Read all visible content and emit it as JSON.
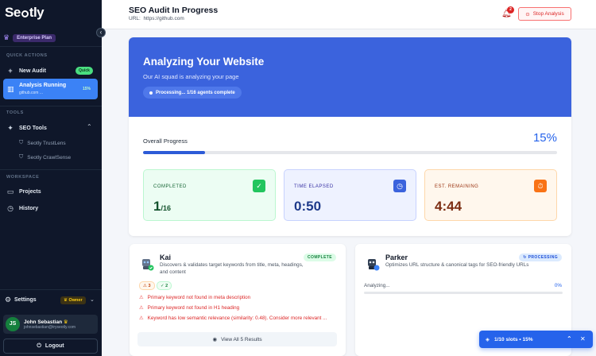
{
  "sidebar": {
    "logo": {
      "prefix": "Se",
      "suffix": "tly"
    },
    "plan_badge": "Enterprise Plan",
    "quick_actions_title": "QUICK ACTIONS",
    "new_audit": {
      "label": "New Audit",
      "badge": "Quick"
    },
    "analysis_running": {
      "label": "Analysis Running",
      "subtitle": "github.com ...",
      "percent": "15%"
    },
    "tools_title": "TOOLS",
    "seo_tools": {
      "label": "SEO Tools",
      "items": [
        {
          "label": "Seotly TrustLens"
        },
        {
          "label": "Seotly CrawlSense"
        }
      ]
    },
    "workspace_title": "WORKSPACE",
    "projects": "Projects",
    "history": "History",
    "settings": {
      "label": "Settings",
      "badge": "Owner"
    },
    "user": {
      "initials": "JS",
      "name": "John Sebastian",
      "email": "johnsebastian@tryseotly.com"
    },
    "logout": "Logout"
  },
  "header": {
    "title": "SEO Audit In Progress",
    "url_label": "URL:",
    "url": "https://github.com",
    "notification_count": "2",
    "stop_label": "Stop Analysis"
  },
  "hero": {
    "title": "Analyzing Your Website",
    "subtitle": "Our AI squad is analyzing your page",
    "status": "Processing... 1/16 agents complete"
  },
  "progress": {
    "label": "Overall Progress",
    "percent_text": "15%",
    "value": 0.15
  },
  "stats": {
    "completed": {
      "label": "COMPLETED",
      "value": "1",
      "total": "/16"
    },
    "elapsed": {
      "label": "TIME ELAPSED",
      "value": "0:50"
    },
    "remaining": {
      "label": "EST. REMAINING",
      "value": "4:44"
    }
  },
  "agents": {
    "kai": {
      "name": "Kai",
      "description": "Discovers & validates target keywords from title, meta, headings, and content",
      "status": "COMPLETE",
      "warnings": "3",
      "passes": "2",
      "issues": [
        "Primary keyword not found in meta description",
        "Primary keyword not found in H1 heading",
        "Keyword has low semantic relevance (similarity: 0.48). Consider more relevant ..."
      ],
      "view_all": "View All 5 Results"
    },
    "parker": {
      "name": "Parker",
      "description": "Optimizes URL structure & canonical tags for SEO-friendly URLs",
      "status": "PROCESSING",
      "progress_label": "Analyzing...",
      "progress_text": "0%",
      "progress_value": 0
    }
  },
  "slots": {
    "label": "1/10 slots • 15%"
  },
  "colors": {
    "accent": "#3b63dd",
    "sidebar": "#0f172a",
    "success": "#22c55e",
    "warning": "#f97316",
    "danger": "#dc2626"
  }
}
